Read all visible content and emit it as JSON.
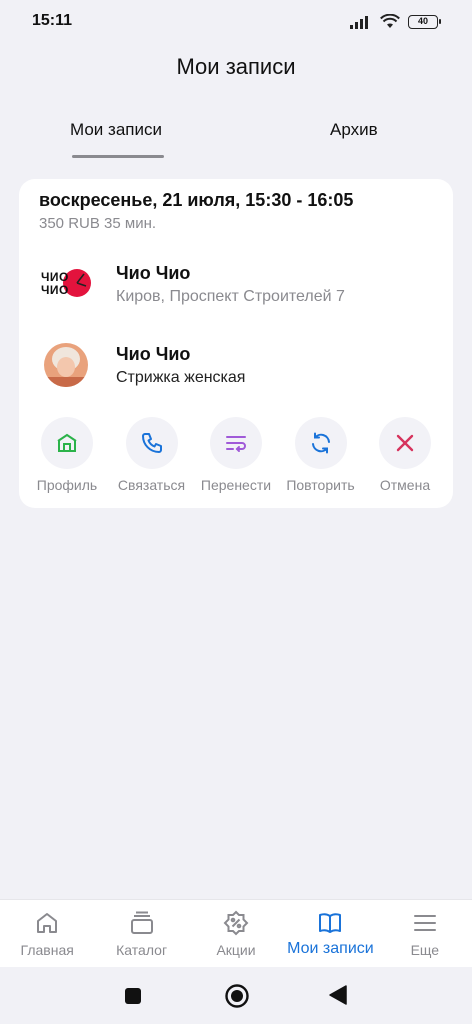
{
  "status": {
    "time": "15:11",
    "battery": "40"
  },
  "title": "Мои записи",
  "tabs": [
    {
      "label": "Мои записи",
      "active": true
    },
    {
      "label": "Архив",
      "active": false
    }
  ],
  "appointment": {
    "date": "воскресенье, 21 июля, 15:30 - 16:05",
    "meta": "350 RUB 35 мин.",
    "salon": {
      "logo_text_1": "ЧИО",
      "logo_text_2": "ЧИО",
      "name": "Чио Чио",
      "address": "Киров, Проспект Строителей 7"
    },
    "master": {
      "name": "Чио Чио",
      "service": "Стрижка женская"
    },
    "actions": [
      {
        "label": "Профиль",
        "icon": "storefront-icon",
        "color": "#2bb34a"
      },
      {
        "label": "Связаться",
        "icon": "phone-icon",
        "color": "#1a73d9"
      },
      {
        "label": "Перенести",
        "icon": "reschedule-icon",
        "color": "#a05ad8"
      },
      {
        "label": "Повторить",
        "icon": "repeat-icon",
        "color": "#1a73d9"
      },
      {
        "label": "Отмена",
        "icon": "close-icon",
        "color": "#d6335d"
      }
    ]
  },
  "bottom_nav": [
    {
      "label": "Главная",
      "icon": "home-icon",
      "active": false
    },
    {
      "label": "Каталог",
      "icon": "catalog-icon",
      "active": false
    },
    {
      "label": "Акции",
      "icon": "discount-icon",
      "active": false
    },
    {
      "label": "Мои записи",
      "icon": "book-icon",
      "active": true
    },
    {
      "label": "Еще",
      "icon": "menu-icon",
      "active": false
    }
  ],
  "colors": {
    "accent": "#1a73d9",
    "background": "#f1f1f6"
  }
}
